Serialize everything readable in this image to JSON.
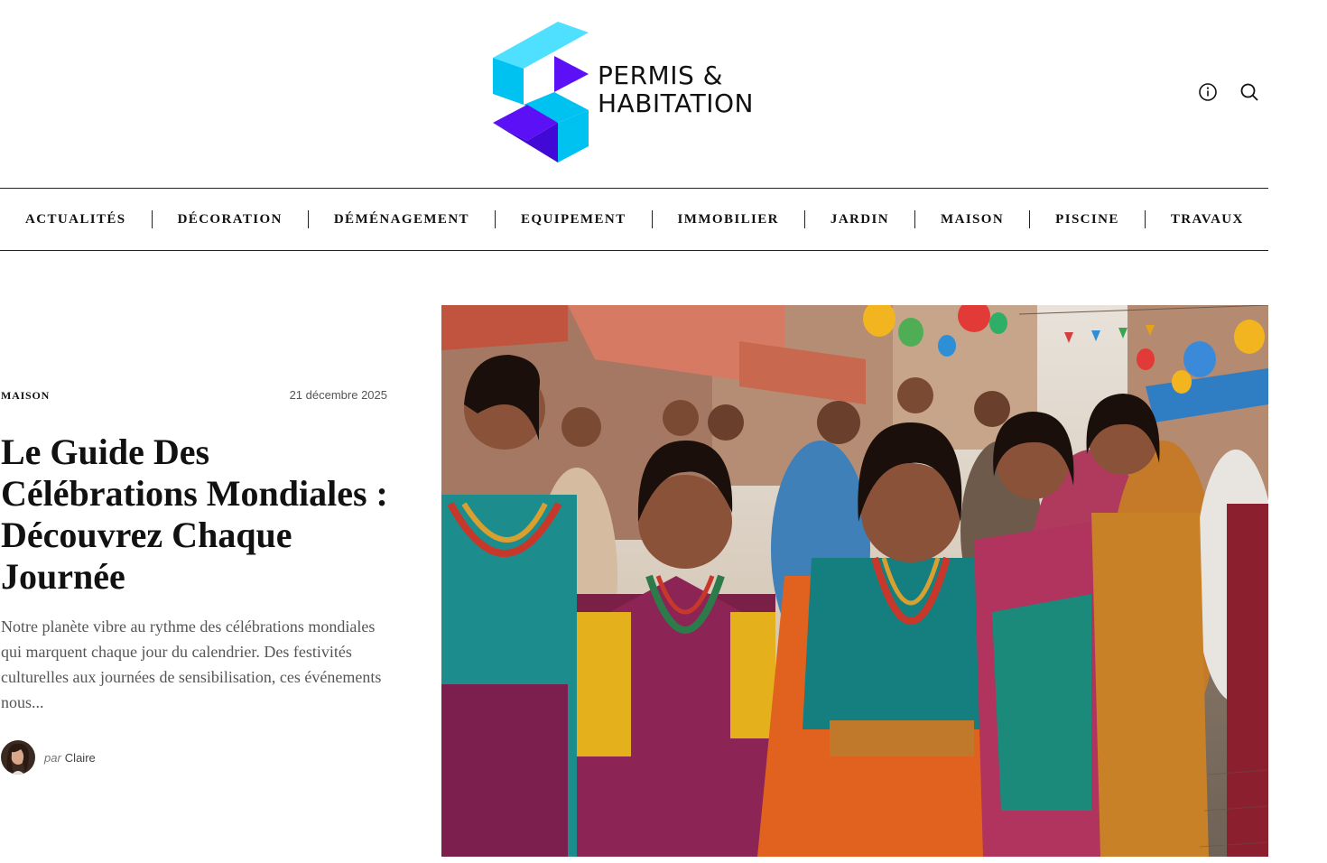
{
  "brand": {
    "line1": "PERMIS &",
    "line2": "HABITATION",
    "colors": {
      "cyan": "#00c2f0",
      "light_cyan": "#4fe0ff",
      "violet": "#5b10f5",
      "deep_violet": "#4209d6"
    }
  },
  "header_icons": [
    {
      "name": "info-icon"
    },
    {
      "name": "search-icon"
    }
  ],
  "nav": {
    "items": [
      {
        "label": "ACTUALITÉS"
      },
      {
        "label": "DÉCORATION"
      },
      {
        "label": "DÉMÉNAGEMENT"
      },
      {
        "label": "EQUIPEMENT"
      },
      {
        "label": "IMMOBILIER"
      },
      {
        "label": "JARDIN"
      },
      {
        "label": "MAISON"
      },
      {
        "label": "PISCINE"
      },
      {
        "label": "TRAVAUX"
      }
    ]
  },
  "article": {
    "category": "MAISON",
    "date": "21 décembre 2025",
    "title": "Le Guide Des Célébrations Mondiales : Découvrez Chaque Journée",
    "excerpt": "Notre planète vibre au rythme des célébrations mondiales qui marquent chaque jour du calendrier. Des festivités culturelles aux journées de sensibilisation, ces événements nous...",
    "author_prefix": "par",
    "author_name": "Claire"
  }
}
